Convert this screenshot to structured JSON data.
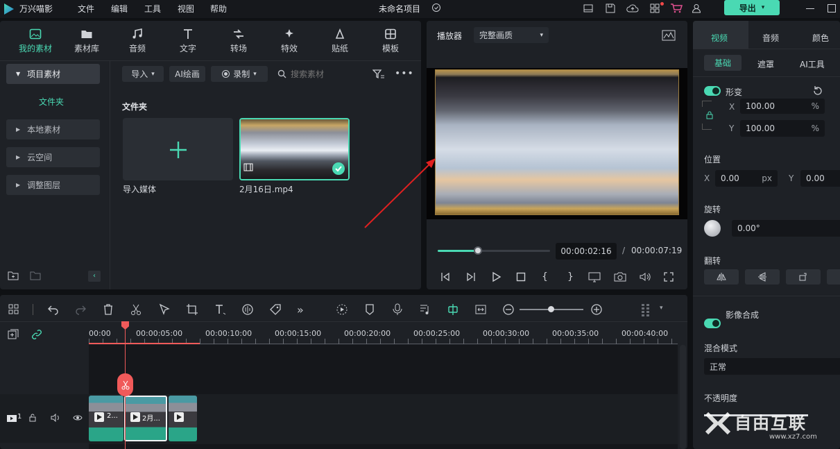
{
  "app": {
    "name": "万兴喵影",
    "project_title": "未命名项目",
    "export_label": "导出"
  },
  "menu": [
    "文件",
    "编辑",
    "工具",
    "视图",
    "帮助"
  ],
  "media_tabs": [
    {
      "label": "我的素材",
      "icon": "folder-image-icon",
      "active": true
    },
    {
      "label": "素材库",
      "icon": "cloud-folder-icon"
    },
    {
      "label": "音频",
      "icon": "music-note-icon"
    },
    {
      "label": "文字",
      "icon": "text-icon"
    },
    {
      "label": "转场",
      "icon": "transition-icon"
    },
    {
      "label": "特效",
      "icon": "sparkle-icon"
    },
    {
      "label": "贴纸",
      "icon": "sticker-icon"
    },
    {
      "label": "模板",
      "icon": "template-icon"
    }
  ],
  "sidebar": {
    "project_media": "项目素材",
    "folder": "文件夹",
    "items": [
      "本地素材",
      "云空间",
      "调整图层"
    ]
  },
  "media_toolbar": {
    "import": "导入",
    "ai_draw": "AI绘画",
    "record": "录制",
    "search_placeholder": "搜索素材"
  },
  "media_grid": {
    "section_title": "文件夹",
    "items": [
      {
        "label": "导入媒体"
      },
      {
        "label": "2月16日.mp4"
      }
    ]
  },
  "player": {
    "title": "播放器",
    "quality": "完整画质",
    "current_time": "00:00:02:16",
    "separator": "/",
    "total_time": "00:00:07:19",
    "progress": 0.36
  },
  "properties": {
    "tabs": [
      "视频",
      "音频",
      "颜色"
    ],
    "subtabs": [
      "基础",
      "遮罩",
      "AI工具"
    ],
    "transform_label": "形变",
    "scale_x_label": "X",
    "scale_x": "100.00",
    "scale_y_label": "Y",
    "scale_y": "100.00",
    "percent": "%",
    "position_label": "位置",
    "pos_x_label": "X",
    "pos_x": "0.00",
    "pos_unit": "px",
    "pos_y_label": "Y",
    "pos_y": "0.00",
    "rotation_label": "旋转",
    "rotation_value": "0.00°",
    "flip_label": "翻转",
    "compositing_label": "影像合成",
    "blend_mode_label": "混合模式",
    "blend_mode_value": "正常",
    "opacity_label": "不透明度"
  },
  "timeline": {
    "ruler": [
      "00:00",
      "00:00:05:00",
      "00:00:10:00",
      "00:00:15:00",
      "00:00:20:00",
      "00:00:25:00",
      "00:00:30:00",
      "00:00:35:00",
      "00:00:40:00"
    ],
    "track_number": "1",
    "clips": [
      {
        "label": "2..."
      },
      {
        "label": "2月..."
      },
      {
        "label": ""
      }
    ]
  },
  "watermark": {
    "text": "自由互联",
    "url": "www.xz7.com"
  },
  "colors": {
    "accent": "#4ad9b3",
    "playhead": "#f05a5a",
    "arrow": "#e02020"
  }
}
